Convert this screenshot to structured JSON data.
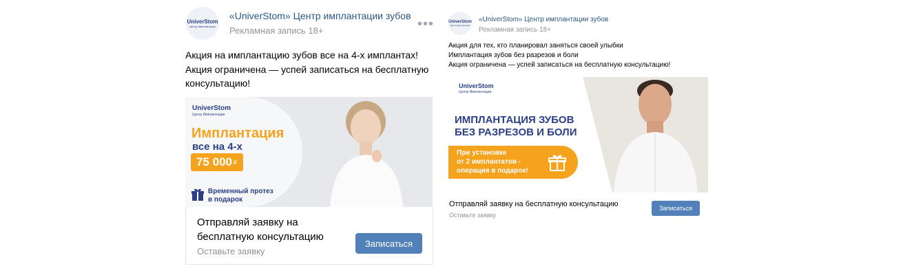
{
  "posts": [
    {
      "author": "«UniverStom» Центр имплантации зубов",
      "meta": "Рекламная запись 18+",
      "avatar_logo": "UniverStom",
      "avatar_logo_sub": "Центр Имплантации",
      "more_icon": "•••",
      "text_lines": [
        "Акция на имплантацию зубов все на 4-х имплантах!",
        "Акция ограничена — успей записаться на бесплатную",
        "консультацию!"
      ],
      "banner": {
        "logo": "UniverStom",
        "logo_sub": "Центр Имплантации",
        "headline": "Имплантация",
        "subheadline": "все на 4-х",
        "price": "75 000",
        "price_currency": "₽",
        "bonus_lines": [
          "Временный протез",
          "в подарок"
        ]
      },
      "cta_text": "Отправляй заявку на бесплатную консультацию",
      "cta_sub": "Оставьте заявку",
      "button": "Записаться"
    },
    {
      "author": "«UniverStom» Центр имплантации зубов",
      "meta": "Рекламная запись 18+",
      "avatar_logo": "UniverStom",
      "avatar_logo_sub": "Центр Имплантации",
      "text_lines": [
        "Акция для тех, кто планировал заняться своей улыбки",
        "Имплантация зубов без разрезов и боли",
        "Акция ограничена — успей записаться на бесплатную консультацию!"
      ],
      "banner": {
        "logo": "UniverStom",
        "logo_sub": "Центр Имплантации",
        "headline_lines": [
          "ИМПЛАНТАЦИЯ ЗУБОВ",
          "БЕЗ РАЗРЕЗОВ И БОЛИ"
        ],
        "offer_lines": [
          "При установке",
          "от 2 имплантатов -",
          "операция в подарок!"
        ]
      },
      "cta_text": "Отправляй заявку на бесплатную консультацию",
      "cta_sub": "Оставьте заявку",
      "button": "Записаться"
    }
  ],
  "colors": {
    "link": "#2a5885",
    "meta": "#939393",
    "button": "#5181b8",
    "brand_navy": "#2b3f86",
    "accent_orange": "#f5a21c"
  }
}
